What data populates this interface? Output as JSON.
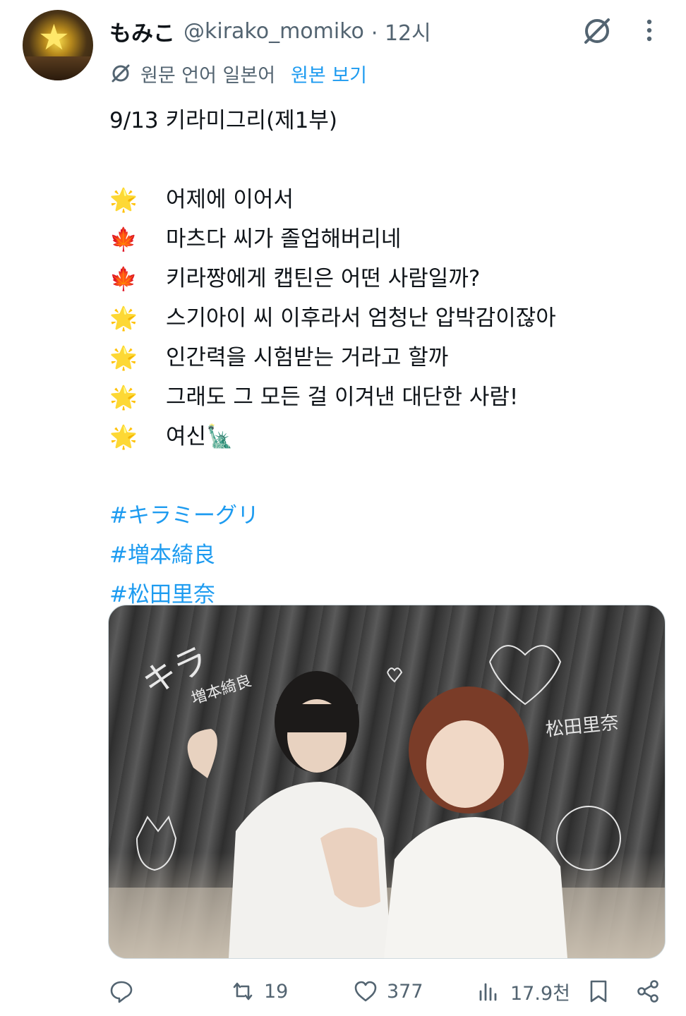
{
  "tweet": {
    "author": {
      "name": "もみこ",
      "handle": "@kirako_momiko",
      "time": "· 12시"
    },
    "translation": {
      "language_label": "원문 언어 일본어",
      "show_original": "원본 보기"
    },
    "text": {
      "title": "9/13 키라미그리(제1부)",
      "lines": [
        {
          "emoji": "🌟",
          "text": "어제에 이어서"
        },
        {
          "emoji": "🍁",
          "text": "마츠다 씨가 졸업해버리네"
        },
        {
          "emoji": "🍁",
          "text": "키라짱에게 캡틴은 어떤 사람일까?"
        },
        {
          "emoji": "🌟",
          "text": "스기아이 씨 이후라서 엄청난 압박감이잖아"
        },
        {
          "emoji": "🌟",
          "text": "인간력을 시험받는 거라고 할까"
        },
        {
          "emoji": "🌟",
          "text": "그래도 그 모든 걸 이겨낸 대단한 사람!"
        },
        {
          "emoji": "🌟",
          "text": "여신🗽"
        }
      ],
      "hashtags": [
        "#キラミーグリ",
        "#増本綺良",
        "#松田里奈"
      ]
    },
    "media": {
      "autographs": [
        "キラ",
        "増本綺良",
        "松田里奈"
      ]
    },
    "actions": {
      "retweets": "19",
      "likes": "377",
      "views": "17.9천"
    }
  },
  "colors": {
    "accent": "#1d9bf0",
    "secondary_text": "#536471",
    "primary_text": "#0f1419"
  },
  "icons": [
    "grok-icon",
    "more-icon",
    "translate-icon",
    "reply-icon",
    "retweet-icon",
    "like-icon",
    "views-icon",
    "bookmark-icon",
    "share-icon"
  ]
}
